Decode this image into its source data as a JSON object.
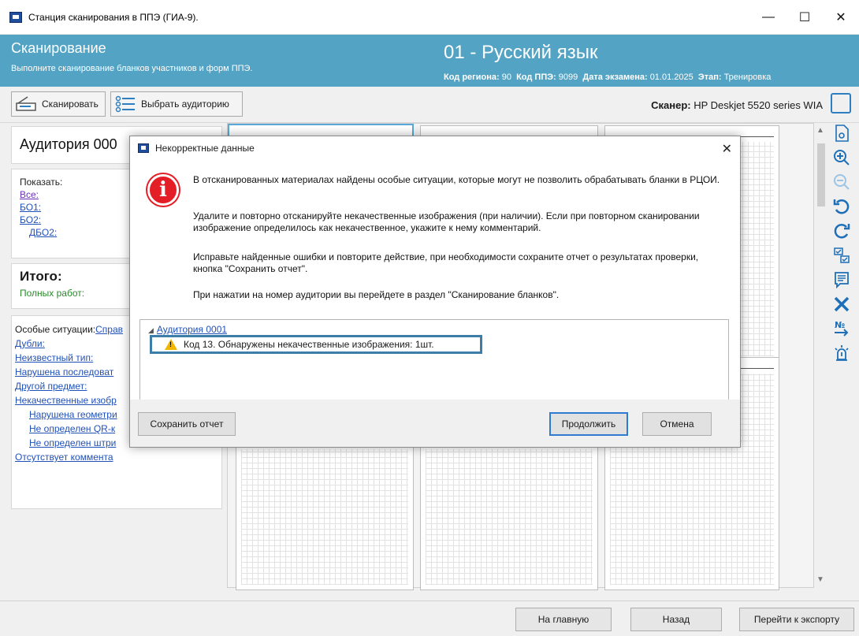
{
  "window": {
    "title": "Станция сканирования в ППЭ (ГИА-9).",
    "minimize": "—",
    "maximize": "☐",
    "close": "✕"
  },
  "header": {
    "title": "Сканирование",
    "subtitle": "Выполните сканирование бланков участников и форм ППЭ.",
    "subject": "01 - Русский язык",
    "region_label": "Код региона:",
    "region_value": "90",
    "ppe_label": "Код ППЭ:",
    "ppe_value": "9099",
    "date_label": "Дата экзамена:",
    "date_value": "01.01.2025",
    "stage_label": "Этап:",
    "stage_value": "Тренировка"
  },
  "toolbar": {
    "scan_label": "Сканировать",
    "choose_label": "Выбрать аудиторию",
    "scanner_label": "Сканер:",
    "scanner_value": "HP Deskjet 5520 series WIA"
  },
  "left": {
    "auditorium": "Аудитория 000",
    "show_label": "Показать:",
    "show_all": "Все:",
    "show_bo1": "БО1:",
    "show_bo2": "БО2:",
    "show_dbo2": "ДБО2:",
    "total_title": "Итого:",
    "full_works": "Полных работ:",
    "special_label": "Особые ситуации:",
    "special_link": "Справ",
    "dups": "Дубли:",
    "unknown_type": "Неизвестный тип:",
    "broken_seq": "Нарушена последоват",
    "other_subject": "Другой предмет:",
    "bad_images": "Некачественные изобр",
    "bad_geometry": "Нарушена геометри",
    "no_qr": "Не определен QR-к",
    "no_barcode": "Не определен штри",
    "no_comment": "Отсутствует коммента"
  },
  "dialog": {
    "title": "Некорректные данные",
    "p1": "В отсканированных материалах найдены особые ситуации, которые могут не позволить обрабатывать бланки в РЦОИ.",
    "p2": "Удалите и повторно отсканируйте некачественные изображения (при наличии). Если при повторном сканировании изображение определилось как некачественное, укажите к нему комментарий.",
    "p3": "Исправьте найденные ошибки и повторите действие, при необходимости сохраните отчет  о результатах проверки, кнопка \"Сохранить отчет\".",
    "p4": "При нажатии на номер аудитории вы перейдете в раздел \"Сканирование бланков\".",
    "tree_root": "Аудитория 0001",
    "tree_item": "Код 13. Обнаружены некачественные изображения: 1шт.",
    "save_report": "Сохранить отчет",
    "continue": "Продолжить",
    "cancel": "Отмена"
  },
  "bottom": {
    "home": "На главную",
    "back": "Назад",
    "export": "Перейти к экспорту"
  },
  "colors": {
    "header_bg": "#53a3c4",
    "link": "#2051b8",
    "error_red": "#e41e26",
    "warning_yellow": "#f2b600",
    "highlight_border": "#3c7ea7",
    "tool_blue": "#1d6fb8"
  },
  "icons": {
    "tools": [
      "document-preview-icon",
      "zoom-in-icon",
      "zoom-out-icon",
      "rotate-left-icon",
      "rotate-right-icon",
      "checklist-icon",
      "comment-icon",
      "delete-icon",
      "renumber-icon",
      "alarm-icon"
    ]
  }
}
